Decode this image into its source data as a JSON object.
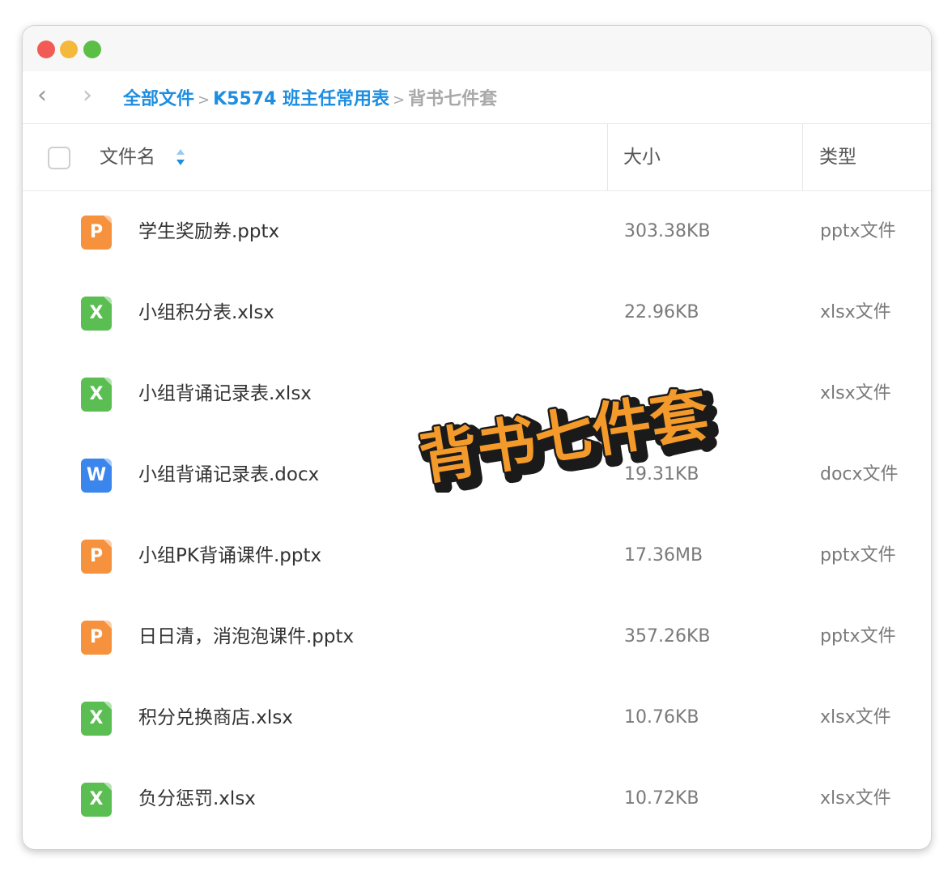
{
  "breadcrumb": {
    "items": [
      "全部文件",
      "K5574 班主任常用表"
    ],
    "separator": ">",
    "current": "背书七件套"
  },
  "nav": {
    "back_icon": "‹",
    "forward_icon": "›"
  },
  "header": {
    "name_label": "文件名",
    "size_label": "大小",
    "type_label": "类型"
  },
  "files": [
    {
      "name": "学生奖励券.pptx",
      "size": "303.38KB",
      "type": "pptx文件",
      "icon": "P",
      "kind": "pptx"
    },
    {
      "name": "小组积分表.xlsx",
      "size": "22.96KB",
      "type": "xlsx文件",
      "icon": "X",
      "kind": "xlsx"
    },
    {
      "name": "小组背诵记录表.xlsx",
      "size": "",
      "type": "xlsx文件",
      "icon": "X",
      "kind": "xlsx"
    },
    {
      "name": "小组背诵记录表.docx",
      "size": "19.31KB",
      "type": "docx文件",
      "icon": "W",
      "kind": "docx"
    },
    {
      "name": "小组PK背诵课件.pptx",
      "size": "17.36MB",
      "type": "pptx文件",
      "icon": "P",
      "kind": "pptx"
    },
    {
      "name": "日日清，消泡泡课件.pptx",
      "size": "357.26KB",
      "type": "pptx文件",
      "icon": "P",
      "kind": "pptx"
    },
    {
      "name": "积分兑换商店.xlsx",
      "size": "10.76KB",
      "type": "xlsx文件",
      "icon": "X",
      "kind": "xlsx"
    },
    {
      "name": "负分惩罚.xlsx",
      "size": "10.72KB",
      "type": "xlsx文件",
      "icon": "X",
      "kind": "xlsx"
    }
  ],
  "overlay": {
    "text": "背书七件套"
  },
  "colors": {
    "link": "#1e8ee0",
    "pptx": "#f6913d",
    "xlsx": "#5bbe52",
    "docx": "#3b86ec",
    "stamp": "#f39a2b"
  }
}
